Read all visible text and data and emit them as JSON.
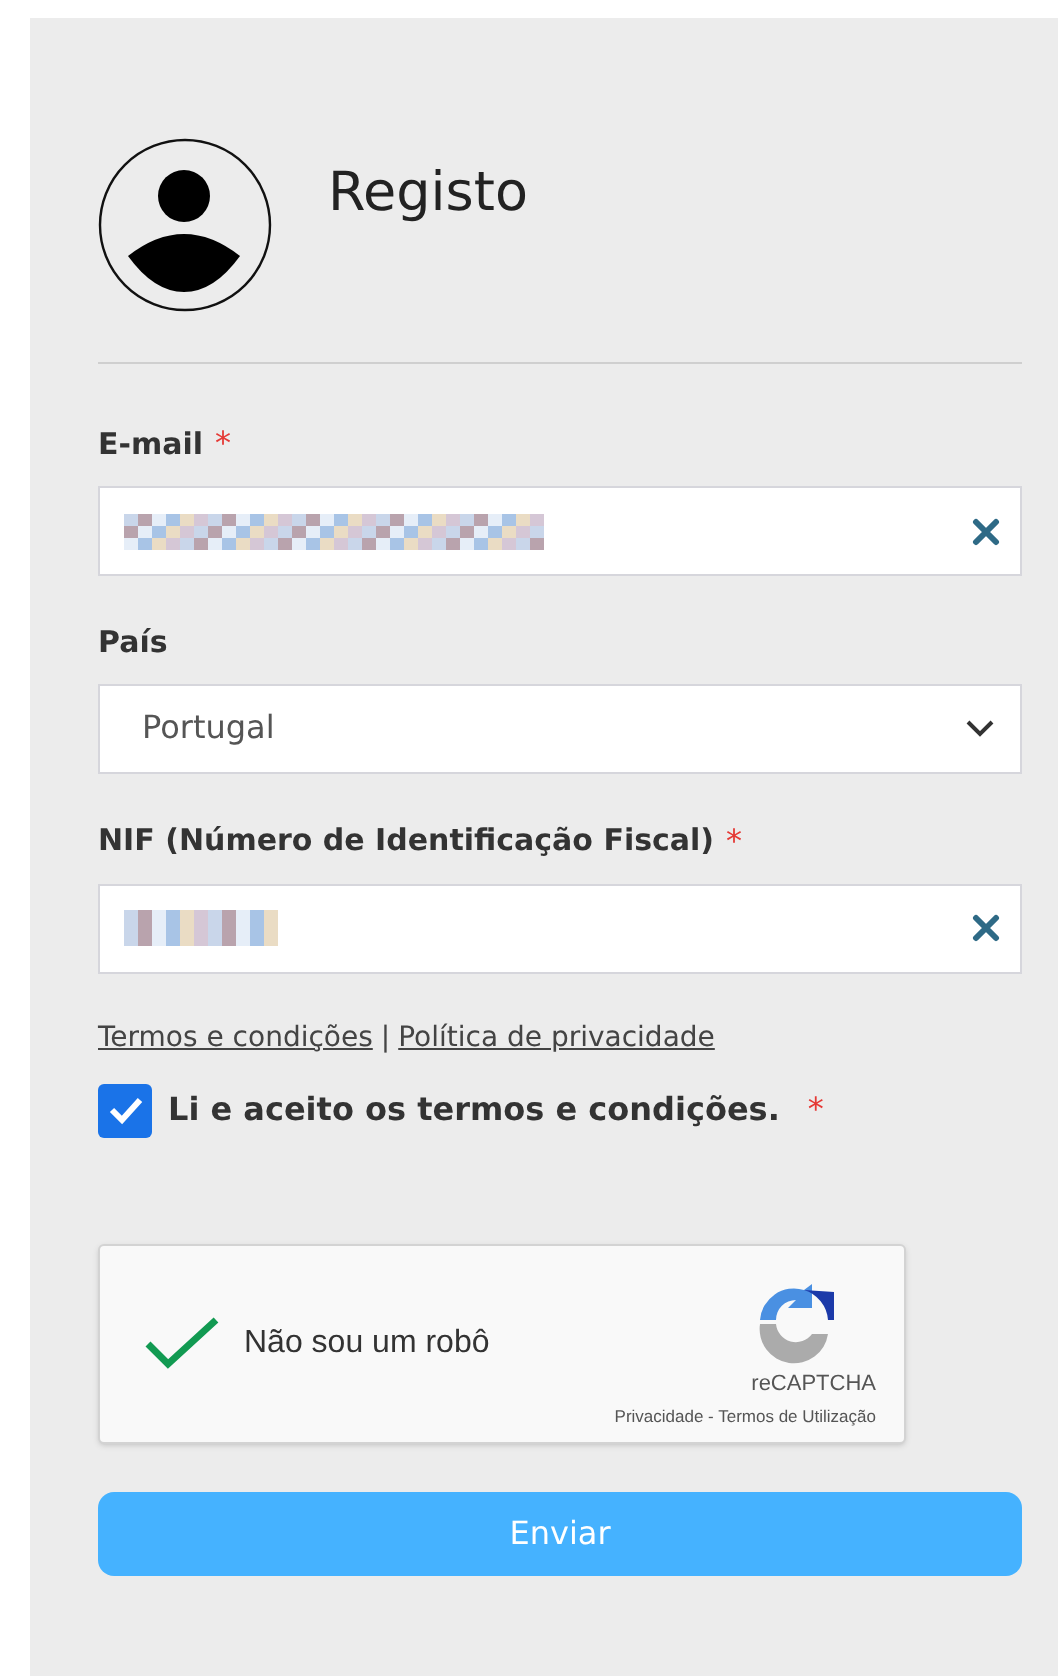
{
  "header": {
    "title": "Registo"
  },
  "fields": [
    {
      "kind": "text",
      "label": "E-mail",
      "required": true,
      "redacted": true,
      "clearable": true
    },
    {
      "kind": "select",
      "label": "País",
      "required": false,
      "value": "Portugal"
    },
    {
      "kind": "text",
      "label": "NIF (Número de Identificação Fiscal)",
      "required": true,
      "redacted": true,
      "clearable": true
    }
  ],
  "required_mark": "*",
  "links": [
    "Termos e condições",
    "Política de privacidade"
  ],
  "link_separator": "|",
  "consent": {
    "label": "Li e aceito os termos e condições.",
    "required": true,
    "checked": true
  },
  "captcha": {
    "label": "Não sou um robô",
    "verified": true,
    "brand": "reCAPTCHA",
    "footer": "Privacidade - Termos de Utilização"
  },
  "submit": {
    "label": "Enviar"
  }
}
